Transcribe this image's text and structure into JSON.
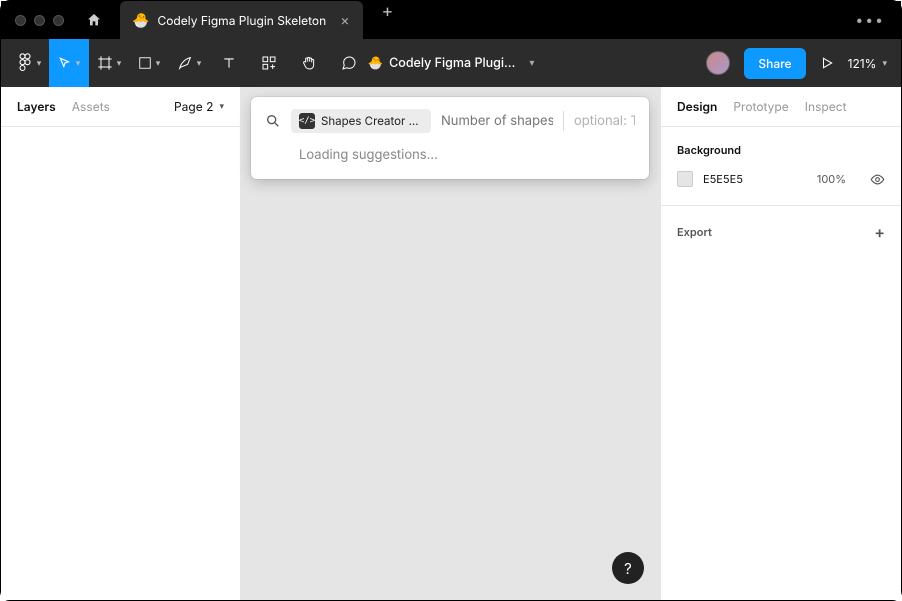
{
  "titlebar": {
    "tab_title": "Codely Figma Plugin Skeleton",
    "tab_emoji": "🐣"
  },
  "toolbar": {
    "file_title": "Codely Figma Plugi…",
    "file_emoji": "🐣",
    "share_label": "Share",
    "zoom": "121%"
  },
  "left": {
    "tabs": [
      "Layers",
      "Assets"
    ],
    "page_label": "Page 2"
  },
  "right": {
    "tabs": [
      "Design",
      "Prototype",
      "Inspect"
    ],
    "bg_title": "Background",
    "bg_hex": "E5E5E5",
    "bg_opacity": "100%",
    "export_title": "Export"
  },
  "popover": {
    "chip": "Shapes Creator Pa…",
    "placeholder": "Number of shapes",
    "optional": "optional: T",
    "loading": "Loading suggestions..."
  },
  "help": "?"
}
